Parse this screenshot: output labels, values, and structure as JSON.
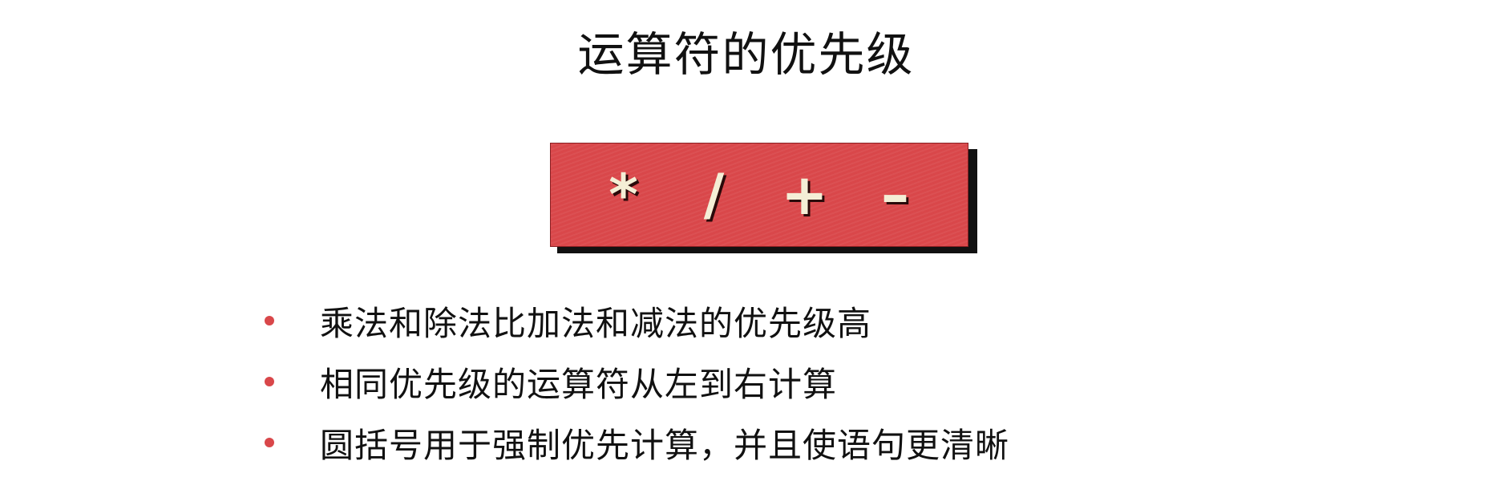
{
  "title": "运算符的优先级",
  "operators": [
    "*",
    "/",
    "+",
    "–"
  ],
  "bullets": [
    "乘法和除法比加法和减法的优先级高",
    "相同优先级的运算符从左到右计算",
    "圆括号用于强制优先计算，并且使语句更清晰"
  ],
  "colors": {
    "box": "#d9474a",
    "operator_text": "#f4eed6",
    "bullet_dot": "#d9474a",
    "text": "#111111"
  }
}
